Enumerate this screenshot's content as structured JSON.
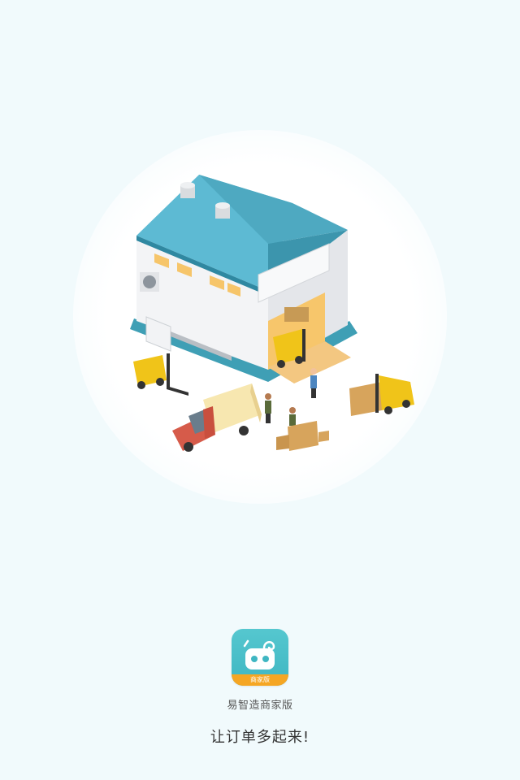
{
  "app": {
    "name": "易智造商家版",
    "badge": "商家版",
    "slogan": "让订单多起来!"
  },
  "illustration": {
    "subject": "warehouse-with-forklifts-and-truck"
  },
  "colors": {
    "background": "#f1fafc",
    "brand": "#47bcc6",
    "badge": "#f5a623",
    "roof": "#58b6cf"
  },
  "icons": [
    "robot-face-icon",
    "warehouse-illustration"
  ]
}
